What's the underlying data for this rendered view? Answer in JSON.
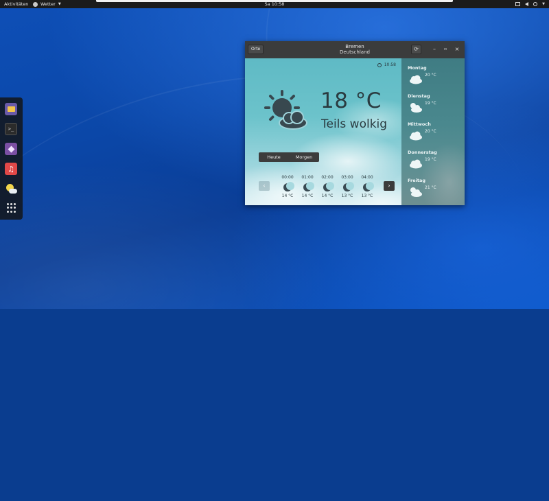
{
  "topbar": {
    "activities": "Aktivitäten",
    "app_name": "Wetter",
    "clock": "Sa 10:58"
  },
  "dock": {
    "items": [
      {
        "name": "files",
        "icon": "folder-icon"
      },
      {
        "name": "terminal",
        "icon": "terminal-icon"
      },
      {
        "name": "software",
        "icon": "software-icon"
      },
      {
        "name": "music",
        "icon": "music-note-icon"
      },
      {
        "name": "weather",
        "icon": "weather-icon"
      },
      {
        "name": "show-applications",
        "icon": "app-grid-icon"
      }
    ]
  },
  "window": {
    "orte_label": "Orte",
    "city": "Bremen",
    "country": "Deutschland"
  },
  "current": {
    "updated_time": "10:58",
    "temperature": "18 °C",
    "condition": "Teils wolkig"
  },
  "switcher": {
    "today": "Heute",
    "tomorrow": "Morgen"
  },
  "hourly": [
    {
      "time": "00:00",
      "temp": "14 °C",
      "icon": "moon-icon"
    },
    {
      "time": "01:00",
      "temp": "14 °C",
      "icon": "moon-icon"
    },
    {
      "time": "02:00",
      "temp": "14 °C",
      "icon": "moon-cloud-icon"
    },
    {
      "time": "03:00",
      "temp": "13 °C",
      "icon": "moon-icon"
    },
    {
      "time": "04:00",
      "temp": "13 °C",
      "icon": "moon-icon"
    }
  ],
  "forecast": [
    {
      "day": "Montag",
      "temp": "20 °C",
      "icon": "cloudy-icon"
    },
    {
      "day": "Dienstag",
      "temp": "19 °C",
      "icon": "sun-cloud-icon"
    },
    {
      "day": "Mittwoch",
      "temp": "20 °C",
      "icon": "cloudy-icon"
    },
    {
      "day": "Donnerstag",
      "temp": "19 °C",
      "icon": "cloudy-icon"
    },
    {
      "day": "Freitag",
      "temp": "21 °C",
      "icon": "sun-cloud-icon"
    }
  ],
  "colors": {
    "topbar": "#1b1b1b",
    "desktop": "#0b47a8",
    "sky": "#6cc3cb",
    "sidebar": "#4a888e",
    "text_dark": "#2a3b40"
  }
}
